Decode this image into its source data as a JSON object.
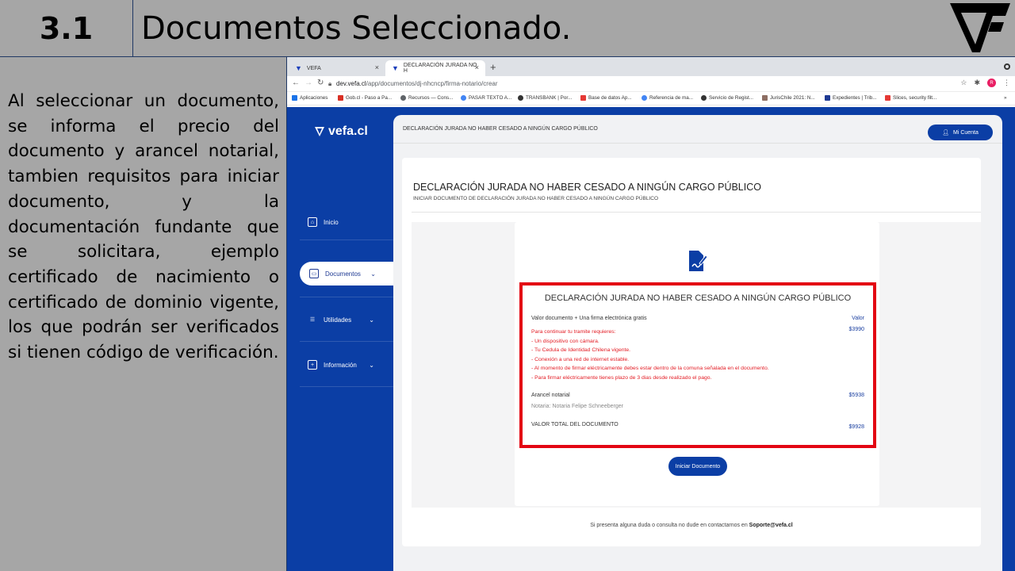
{
  "slide": {
    "number": "3.1",
    "title": "Documentos Seleccionado.",
    "description": "Al seleccionar un documento, se informa el precio del documento y arancel notarial, tambien requisitos para iniciar documento, y la documentación fundante que se solicitara, ejemplo certificado de nacimiento o certificado de dominio vigente, los que podrán ser verificados si tienen código de verificación."
  },
  "browser": {
    "tabs": [
      {
        "label": "VEFA",
        "close": "×"
      },
      {
        "label": "DECLARACIÓN JURADA NO H",
        "close": "×"
      }
    ],
    "new_tab": "+",
    "url_host": "dev.vefa.cl",
    "url_path": "/app/documentos/dj-nhcncp/firma-notario/crear",
    "bookmarks": [
      {
        "label": "Aplicaciones",
        "color": "#1a73e8"
      },
      {
        "label": "Gob.cl - Paso a Pa...",
        "color": "#d93025"
      },
      {
        "label": "Recursos — Cons...",
        "color": "#5f6368"
      },
      {
        "label": "PASAR TEXTO A...",
        "color": "#4285f4"
      },
      {
        "label": "TRANSBANK | Por...",
        "color": "#333333"
      },
      {
        "label": "Base de datos Ap...",
        "color": "#e53935"
      },
      {
        "label": "Referencia de ma...",
        "color": "#4285f4"
      },
      {
        "label": "Servicio de Regist...",
        "color": "#333333"
      },
      {
        "label": "JurisChile 2021: N...",
        "color": "#8d6e63"
      },
      {
        "label": "Expedientes | Trib...",
        "color": "#1f3a93"
      },
      {
        "label": "Slices, security filt...",
        "color": "#e53935"
      }
    ],
    "bookmarks_more": "»",
    "profile_initial": "R"
  },
  "app": {
    "logo": "vefa.cl",
    "sidebar": [
      {
        "label": "Inicio",
        "icon": "home-icon"
      },
      {
        "label": "Documentos",
        "icon": "folder-icon"
      },
      {
        "label": "Utilidades",
        "icon": "list-icon"
      },
      {
        "label": "Información",
        "icon": "plus-square-icon"
      }
    ],
    "topbar_title": "DECLARACIÓN JURADA NO HABER CESADO A NINGÚN CARGO PÚBLICO",
    "account_label": "Mi Cuenta",
    "card_title": "DECLARACIÓN JURADA NO HABER CESADO A NINGÚN CARGO PÚBLICO",
    "card_subtitle": "INICIAR DOCUMENTO DE DECLARACIÓN JURADA NO HABER CESADO A NINGÚN CARGO PÚBLICO",
    "doc": {
      "title": "DECLARACIÓN JURADA NO HABER CESADO A NINGÚN CARGO PÚBLICO",
      "valor_label": "Valor documento + Una firma electrónica gratis",
      "valor_header": "Valor",
      "valor_amount": "$3990",
      "requirements": [
        "Para continuar tu tramite requieres:",
        "- Un dispositivo con cámara.",
        "- Tu Cedula de Identidad Chilena vigente.",
        "- Conexión a una red de internet estable.",
        "- Al momento de firmar eléctricamente debes estar dentro de la comuna señalada en el documento.",
        "- Para firmar eléctricamente tienes plazo de 3 dias desde realizado el pago."
      ],
      "arancel_label": "Arancel notarial",
      "arancel_amount": "$5938",
      "notaria": "Notaria: Notaria Felipe Schneeberger",
      "total_label": "VALOR TOTAL DEL DOCUMENTO",
      "total_amount": "$9928"
    },
    "start_button": "Iniciar Documento",
    "footer_text": "Si presenta alguna duda o consulta no dude en contactarnos en ",
    "footer_email": "Soporte@vefa.cl"
  }
}
